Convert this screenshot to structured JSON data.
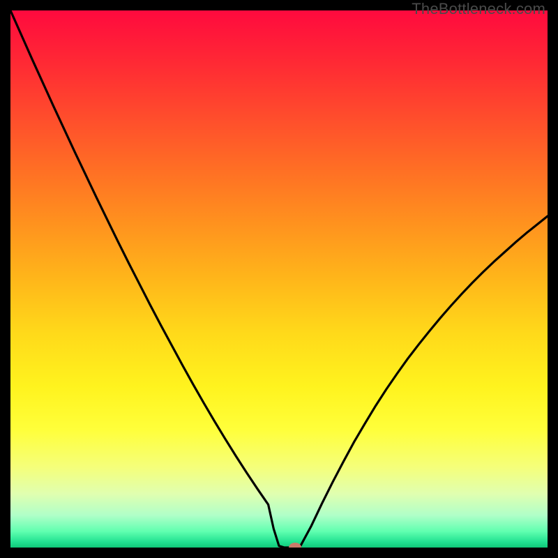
{
  "watermark": "TheBottleneck.com",
  "chart_data": {
    "type": "line",
    "title": "",
    "xlabel": "",
    "ylabel": "",
    "xlim": [
      0,
      100
    ],
    "ylim": [
      0,
      100
    ],
    "x": [
      0,
      2,
      4,
      6,
      8,
      10,
      12,
      14,
      16,
      18,
      20,
      22,
      24,
      26,
      28,
      30,
      32,
      34,
      36,
      38,
      40,
      42,
      44,
      46,
      48,
      49,
      50,
      51,
      52,
      53,
      54,
      56,
      58,
      60,
      62,
      64,
      66,
      68,
      70,
      72,
      74,
      76,
      78,
      80,
      82,
      84,
      86,
      88,
      90,
      92,
      94,
      96,
      98,
      100
    ],
    "values": [
      100,
      95.5,
      91,
      86.6,
      82.2,
      77.9,
      73.6,
      69.4,
      65.2,
      61.1,
      57,
      53,
      49.1,
      45.2,
      41.4,
      37.7,
      34,
      30.4,
      26.9,
      23.5,
      20.2,
      17,
      13.9,
      10.9,
      8.0,
      3.5,
      0.3,
      0.0,
      0.0,
      0.0,
      0.3,
      4.0,
      8.2,
      12.2,
      16.0,
      19.7,
      23.1,
      26.4,
      29.5,
      32.4,
      35.2,
      37.8,
      40.3,
      42.7,
      45.0,
      47.2,
      49.3,
      51.3,
      53.2,
      55.0,
      56.8,
      58.5,
      60.1,
      61.7
    ],
    "gradient_stops": [
      {
        "pos": 0.0,
        "color": "#ff0a3e"
      },
      {
        "pos": 0.1,
        "color": "#ff2a34"
      },
      {
        "pos": 0.2,
        "color": "#ff4d2c"
      },
      {
        "pos": 0.3,
        "color": "#ff7024"
      },
      {
        "pos": 0.4,
        "color": "#ff931e"
      },
      {
        "pos": 0.5,
        "color": "#ffb61a"
      },
      {
        "pos": 0.6,
        "color": "#ffd91a"
      },
      {
        "pos": 0.7,
        "color": "#fff31e"
      },
      {
        "pos": 0.78,
        "color": "#ffff3a"
      },
      {
        "pos": 0.85,
        "color": "#f5ff7a"
      },
      {
        "pos": 0.9,
        "color": "#e0ffb0"
      },
      {
        "pos": 0.94,
        "color": "#b0ffc8"
      },
      {
        "pos": 0.97,
        "color": "#60ffb0"
      },
      {
        "pos": 0.99,
        "color": "#20e090"
      },
      {
        "pos": 1.0,
        "color": "#10c878"
      }
    ],
    "marker": {
      "x": 53,
      "y": 0.0,
      "color": "#c97a6a",
      "rx": 9,
      "ry": 7
    }
  }
}
